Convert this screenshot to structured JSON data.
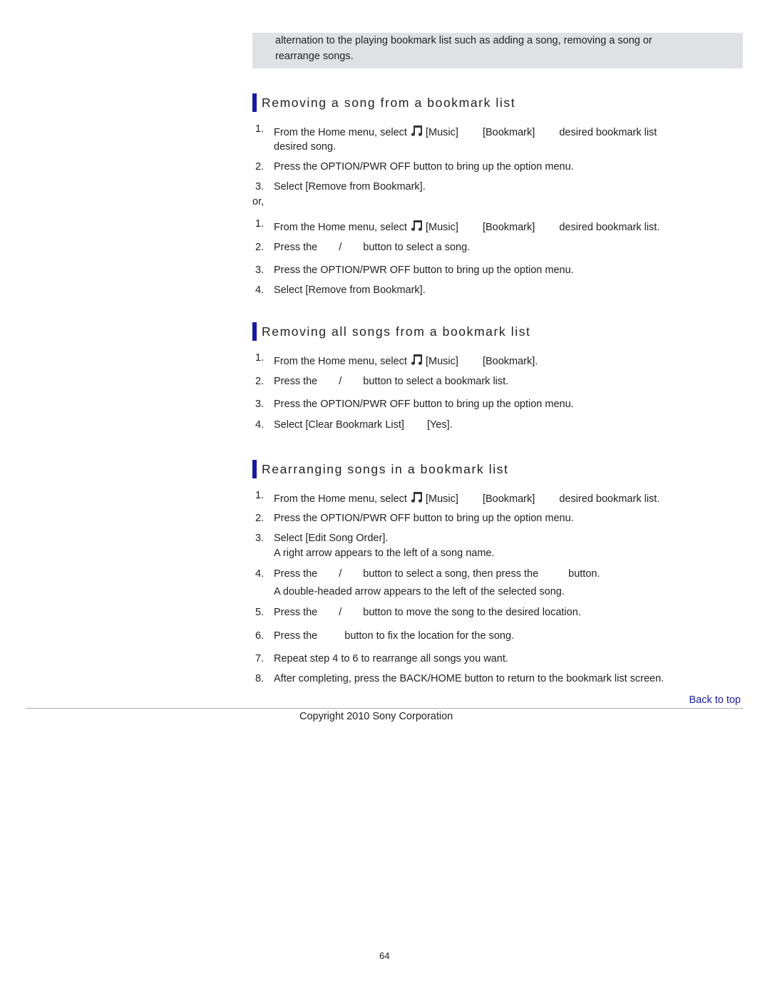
{
  "note": {
    "line1": "alternation to the playing bookmark list such as adding a song, removing a song or",
    "line2": "rearrange songs."
  },
  "sections": [
    {
      "title": "Removing a song from a bookmark list",
      "steps": [
        {
          "num": "1.",
          "a": "From the Home menu, select",
          "b": "[Music]",
          "c": "[Bookmark]",
          "d": "desired bookmark list",
          "e": "desired song."
        },
        {
          "num": "2.",
          "text": "Press the OPTION/PWR OFF button to bring up the option menu."
        },
        {
          "num": "3.",
          "text": "Select [Remove from Bookmark]."
        }
      ],
      "or": "or,",
      "alt_steps": [
        {
          "num": "1.",
          "a": "From the Home menu, select",
          "b": "[Music]",
          "c": "[Bookmark]",
          "d": "desired bookmark list."
        },
        {
          "num": "2.",
          "a": "Press the",
          "b": "/",
          "c": "button to select a song."
        },
        {
          "num": "3.",
          "text": "Press the OPTION/PWR OFF button to bring up the option menu."
        },
        {
          "num": "4.",
          "text": "Select [Remove from Bookmark]."
        }
      ]
    },
    {
      "title": "Removing all songs from a bookmark list",
      "steps": [
        {
          "num": "1.",
          "a": "From the Home menu, select",
          "b": "[Music]",
          "c": "[Bookmark]."
        },
        {
          "num": "2.",
          "a": "Press the",
          "b": "/",
          "c": "button to select a bookmark list."
        },
        {
          "num": "3.",
          "text": "Press the OPTION/PWR OFF button to bring up the option menu."
        },
        {
          "num": "4.",
          "a": "Select [Clear Bookmark List]",
          "b": "[Yes]."
        }
      ]
    },
    {
      "title": "Rearranging songs in a bookmark list",
      "steps": [
        {
          "num": "1.",
          "a": "From the Home menu, select",
          "b": "[Music]",
          "c": "[Bookmark]",
          "d": "desired bookmark list."
        },
        {
          "num": "2.",
          "text": "Press the OPTION/PWR OFF button to bring up the option menu."
        },
        {
          "num": "3.",
          "text": "Select [Edit Song Order].",
          "sub": "A right arrow appears to the left of a song name."
        },
        {
          "num": "4.",
          "a": "Press the",
          "b": "/",
          "c": "button to select a song, then press the",
          "d": "button.",
          "sub": "A double-headed arrow appears to the left of the selected song."
        },
        {
          "num": "5.",
          "a": "Press the",
          "b": "/",
          "c": "button to move the song to the desired location."
        },
        {
          "num": "6.",
          "a": "Press the",
          "b": "button to fix the location for the song."
        },
        {
          "num": "7.",
          "text": "Repeat step 4 to 6 to rearrange all songs you want."
        },
        {
          "num": "8.",
          "text": "After completing, press the BACK/HOME button to return to the bookmark list screen."
        }
      ]
    }
  ],
  "footer": {
    "back_to_top": "Back to top",
    "copyright": "Copyright 2010 Sony Corporation",
    "page_number": "64"
  },
  "icons": {
    "music": "music-note-icon"
  },
  "colors": {
    "accent": "#1a1aa0",
    "note_bg": "#dfe1e5"
  }
}
